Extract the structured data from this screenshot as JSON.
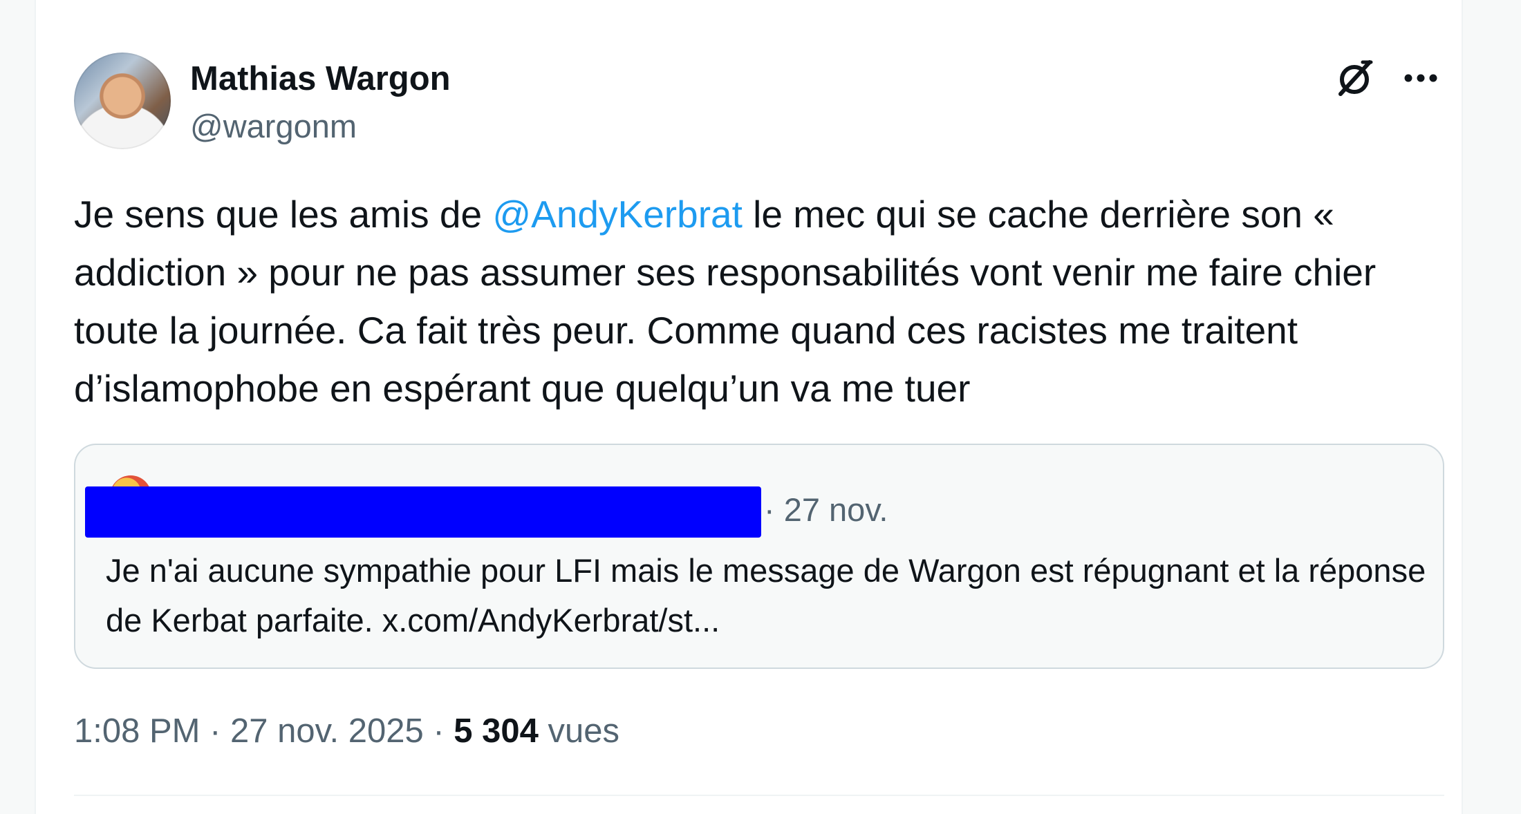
{
  "author": {
    "name": "Mathias Wargon",
    "handle": "@wargonm"
  },
  "post": {
    "text_before_mention": "Je sens que les amis de ",
    "mention": "@AndyKerbrat",
    "text_after_mention": " le mec qui se cache derrière son « addiction » pour ne pas assumer ses responsabilités vont venir me faire chier toute la journée. Ca fait très peur. Comme quand ces racistes me traitent d’islamophobe en espérant que quelqu’un va me tuer"
  },
  "quote": {
    "date": "· 27 nov.",
    "text": "Je n'ai aucune sympathie pour LFI mais le message de Wargon est répugnant et la réponse de Kerbat parfaite. x.com/AndyKerbrat/st..."
  },
  "meta": {
    "time": "1:08 PM",
    "separator1": " · ",
    "date": "27 nov. 2025",
    "separator2": " · ",
    "views_count": "5 304",
    "views_label": " vues"
  },
  "icons": {
    "grok": "grok-icon",
    "more": "more-options-icon"
  },
  "colors": {
    "accent": "#1d9bf0",
    "redaction": "#0000ff",
    "text": "#0f1419",
    "secondary_text": "#536471"
  }
}
